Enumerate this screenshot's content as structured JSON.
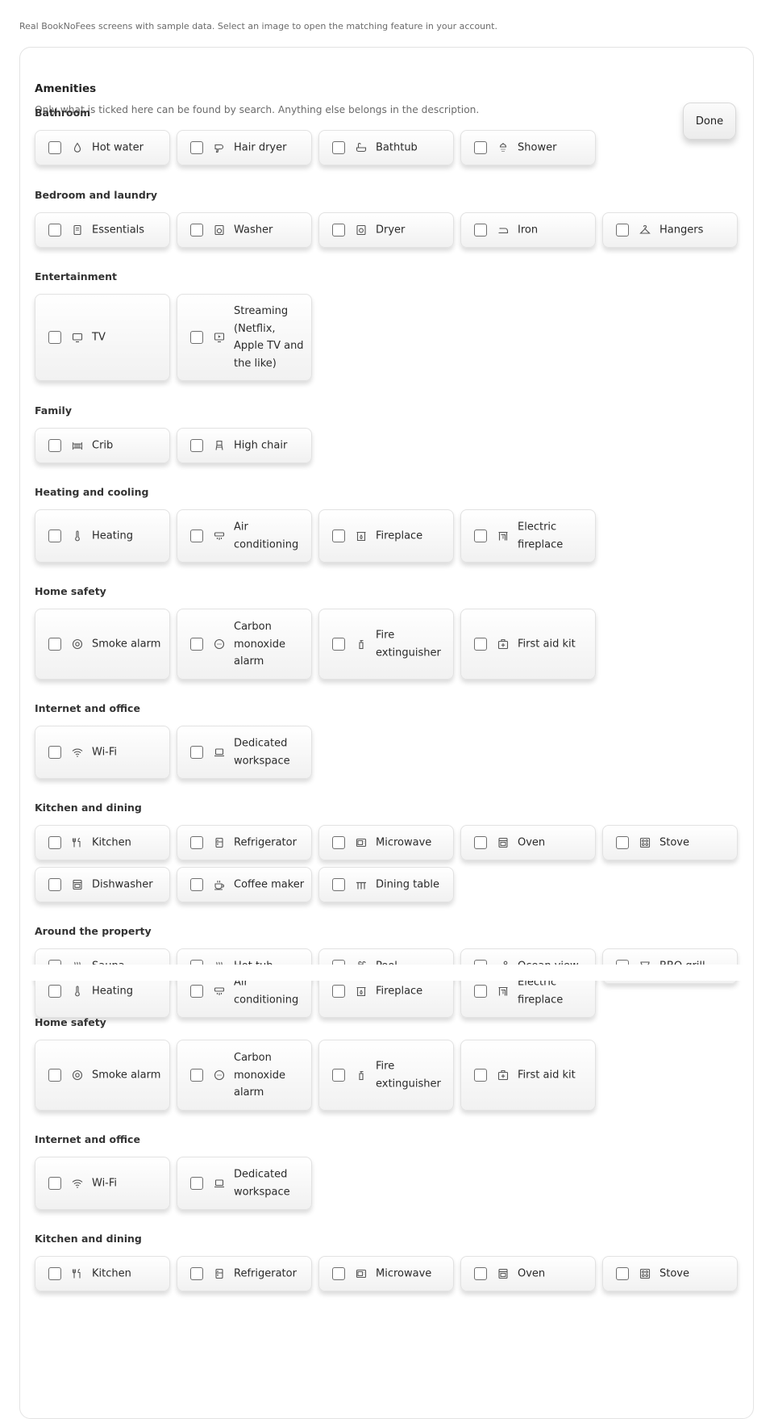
{
  "caption": "Real BookNoFees screens with sample data. Select an image to open the matching feature in your account.",
  "panel": {
    "title": "Amenities",
    "subtitle": "Only what is ticked here can be found by search. Anything else belongs in the description.",
    "done_label": "Done"
  },
  "sections": {
    "bathroom": {
      "title": "Bathroom",
      "items": [
        "Hot water",
        "Hair dryer",
        "Bathtub",
        "Shower"
      ]
    },
    "bedroom": {
      "title": "Bedroom and laundry",
      "items": [
        "Essentials",
        "Washer",
        "Dryer",
        "Iron",
        "Hangers"
      ]
    },
    "entertainment": {
      "title": "Entertainment",
      "items": [
        "TV",
        "Streaming (Netflix, Apple TV and the like)"
      ]
    },
    "family": {
      "title": "Family",
      "items": [
        "Crib",
        "High chair"
      ]
    },
    "heating": {
      "title": "Heating and cooling",
      "items": [
        "Heating",
        "Air conditioning",
        "Fireplace",
        "Electric fireplace"
      ]
    },
    "safety": {
      "title": "Home safety",
      "items": [
        "Smoke alarm",
        "Carbon monoxide alarm",
        "Fire extinguisher",
        "First aid kit"
      ]
    },
    "internet": {
      "title": "Internet and office",
      "items": [
        "Wi-Fi",
        "Dedicated workspace"
      ]
    },
    "kitchen": {
      "title": "Kitchen and dining",
      "items": [
        "Kitchen",
        "Refrigerator",
        "Microwave",
        "Oven",
        "Stove",
        "Dishwasher",
        "Coffee maker",
        "Dining table"
      ]
    },
    "around": {
      "title": "Around the property",
      "items": [
        "Sauna",
        "Hot tub",
        "Pool",
        "Ocean view",
        "BBQ grill"
      ]
    }
  },
  "icons": [
    "droplet-icon",
    "hair-dryer-icon",
    "bathtub-icon",
    "shower-icon",
    "essentials-icon",
    "washer-icon",
    "dryer-icon",
    "iron-icon",
    "hanger-icon",
    "tv-icon",
    "streaming-icon",
    "crib-icon",
    "high-chair-icon",
    "thermometer-icon",
    "air-conditioner-icon",
    "fireplace-icon",
    "electric-fireplace-icon",
    "smoke-alarm-icon",
    "co-alarm-icon",
    "fire-extinguisher-icon",
    "first-aid-icon",
    "wifi-icon",
    "laptop-icon",
    "kitchen-icon",
    "refrigerator-icon",
    "microwave-icon",
    "oven-icon",
    "stove-icon",
    "dishwasher-icon",
    "coffee-icon",
    "dining-table-icon",
    "sauna-icon",
    "hot-tub-icon",
    "pool-icon",
    "ocean-view-icon",
    "bbq-icon"
  ],
  "colors": {
    "text": "#222222",
    "muted": "#6b6b6b",
    "border": "#e2e2e2"
  }
}
